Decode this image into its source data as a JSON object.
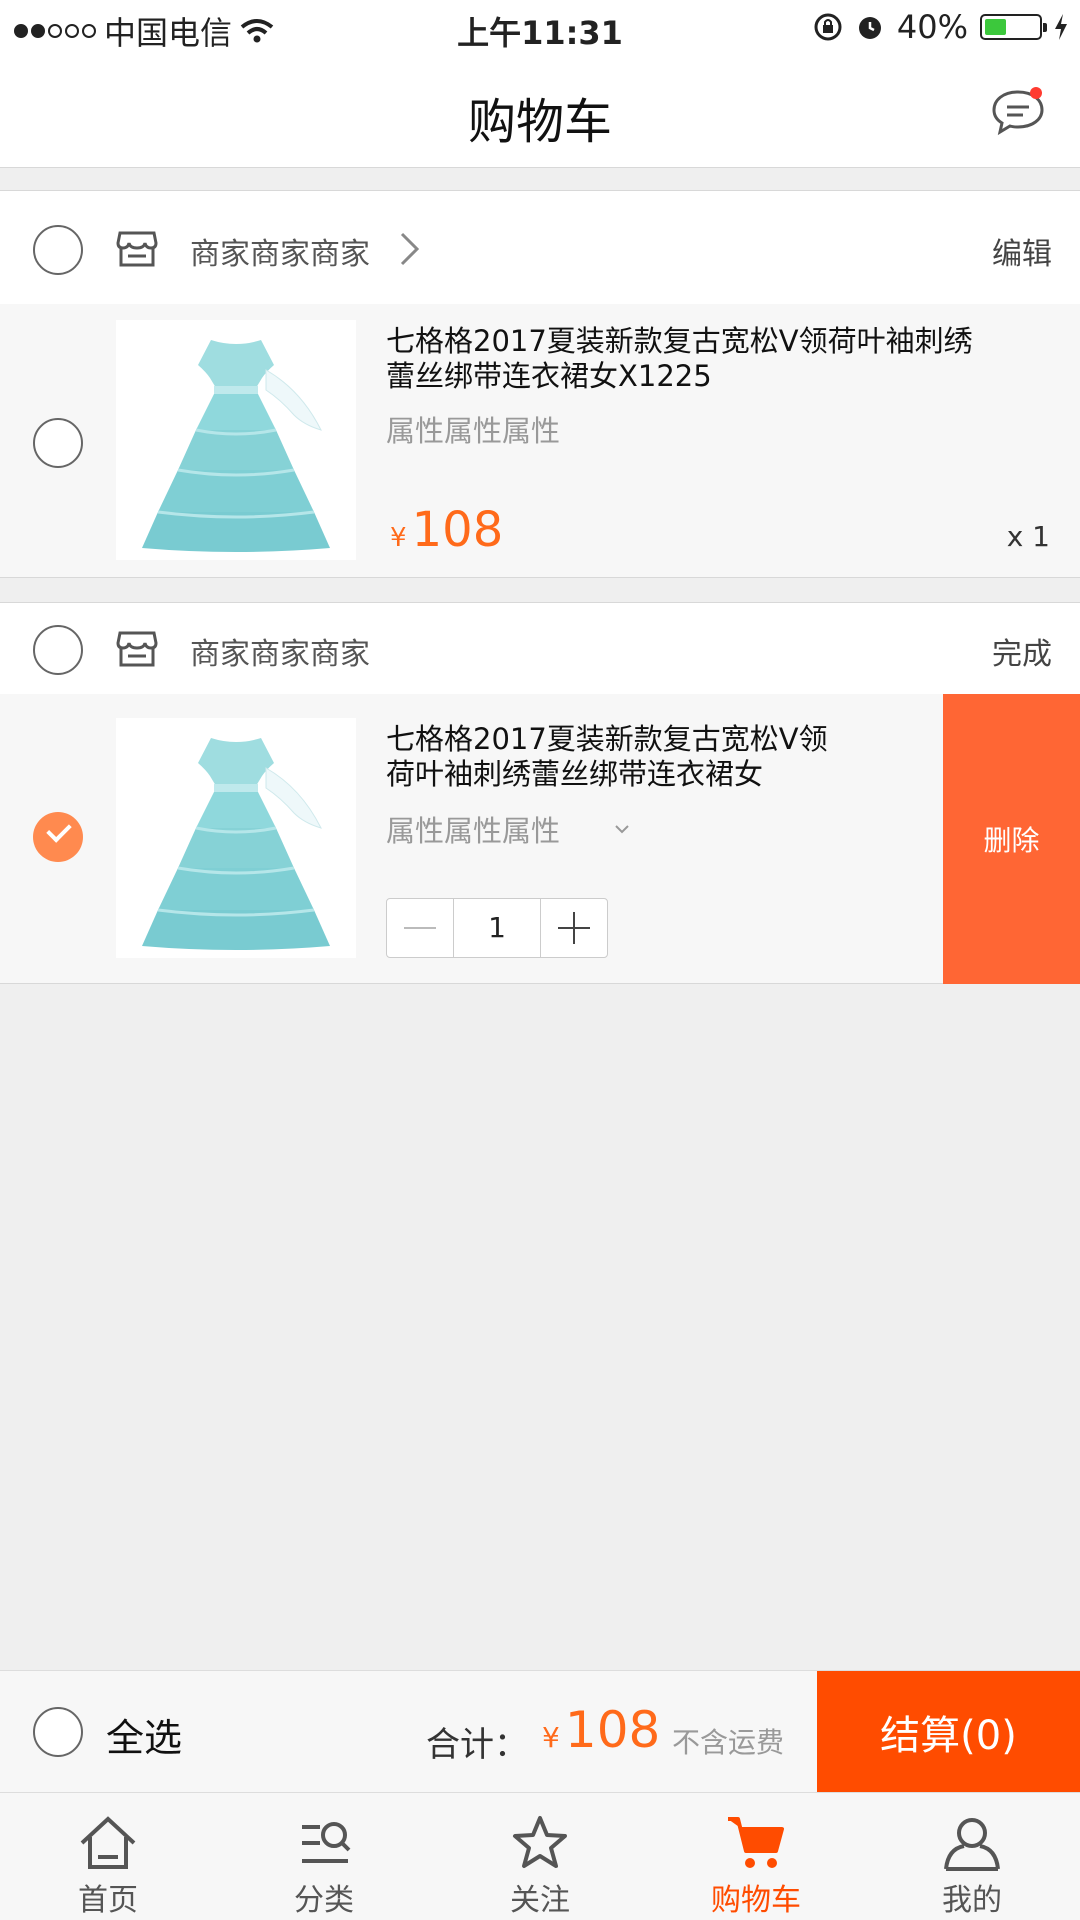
{
  "status_bar": {
    "carrier": "中国电信",
    "time": "上午11:31",
    "battery": "40%",
    "battery_level": 0.4
  },
  "nav": {
    "title": "购物车"
  },
  "shops": [
    {
      "name": "商家商家商家",
      "action": "编辑",
      "item": {
        "title_line1": "七格格2017夏装新款复古宽松V领荷叶袖刺绣",
        "title_line2": "蕾丝绑带连衣裙女X1225",
        "attr": "属性属性属性",
        "currency": "¥",
        "price": "108",
        "qty": "x 1"
      }
    },
    {
      "name": "商家商家商家",
      "action": "完成",
      "item": {
        "title_line1": "七格格2017夏装新款复古宽松V领",
        "title_line2": "荷叶袖刺绣蕾丝绑带连衣裙女",
        "attr": "属性属性属性",
        "quantity": "1",
        "delete_label": "删除"
      }
    }
  ],
  "checkout": {
    "select_all": "全选",
    "total_label": "合计：",
    "currency": "¥",
    "total": "108",
    "shipping_note": "不含运费",
    "settle": "结算(0)"
  },
  "tabs": [
    {
      "label": "首页",
      "icon": "home-icon"
    },
    {
      "label": "分类",
      "icon": "category-search-icon"
    },
    {
      "label": "关注",
      "icon": "star-icon"
    },
    {
      "label": "购物车",
      "icon": "cart-icon",
      "active": true
    },
    {
      "label": "我的",
      "icon": "user-icon"
    }
  ],
  "colors": {
    "accent": "#ff4c00",
    "price": "#ff6a1a",
    "delete": "#ff6634",
    "checked": "#ff8a4f"
  }
}
